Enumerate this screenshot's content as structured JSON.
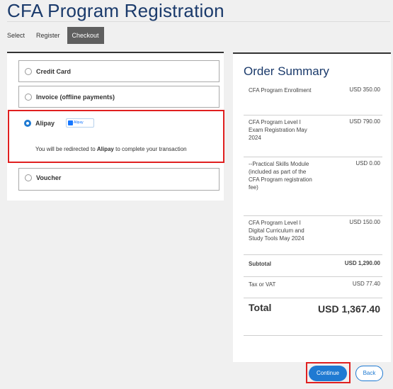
{
  "page": {
    "title": "CFA Program Registration"
  },
  "steps": [
    {
      "label": "Select"
    },
    {
      "label": "Register"
    },
    {
      "label": "Checkout",
      "active": true
    }
  ],
  "payment_options": {
    "credit_card": {
      "label": "Credit Card",
      "selected": false
    },
    "invoice": {
      "label": "Invoice (offline payments)",
      "selected": false
    },
    "alipay": {
      "label": "Alipay",
      "logo_text": "Alipay",
      "selected": true,
      "redirect_prefix": "You will be redirected to ",
      "redirect_name": "Alipay",
      "redirect_suffix": " to complete your transaction"
    },
    "voucher": {
      "label": "Voucher",
      "selected": false
    }
  },
  "order_summary": {
    "title": "Order Summary",
    "items": [
      {
        "desc": "CFA Program Enrollment",
        "amount": "USD 350.00"
      },
      {
        "desc": "CFA Program Level I Exam Registration May 2024",
        "amount": "USD 790.00"
      },
      {
        "desc": "--Practical Skills Module (included as part of the CFA Program registration fee)",
        "amount": "USD 0.00"
      },
      {
        "desc": "CFA Program Level I Digital Curriculum and Study Tools May 2024",
        "amount": "USD 150.00"
      }
    ],
    "subtotal": {
      "label": "Subtotal",
      "amount": "USD 1,290.00"
    },
    "tax": {
      "label": "Tax or VAT",
      "amount": "USD 77.40"
    },
    "total": {
      "label": "Total",
      "amount": "USD 1,367.40"
    }
  },
  "buttons": {
    "continue": "Continue",
    "back": "Back"
  },
  "colors": {
    "accent": "#1f7ad2",
    "title": "#1a3a6b",
    "highlight": "#e02020",
    "active_step": "#5f5f5f"
  }
}
